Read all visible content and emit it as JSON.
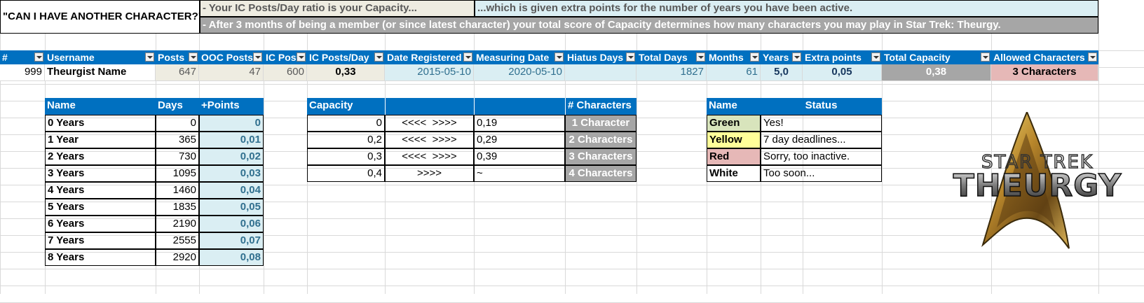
{
  "banner": {
    "question": "\"CAN I HAVE ANOTHER CHARACTER?\"",
    "line1a": "- Your IC Posts/Day ratio is your Capacity...",
    "line1b": "...which is given extra points for the number of years you have been active.",
    "line2": "- After 3 months of being a member (or since latest character) your total score of Capacity determines how many characters you may play in Star Trek: Theurgy."
  },
  "main_table": {
    "headers": [
      "#",
      "Username",
      "Posts",
      "OOC Posts",
      "IC Post",
      "IC Posts/Day",
      "Date Registered",
      "Measuring Date",
      "Hiatus Days",
      "Total Days",
      "Months",
      "Years",
      "Extra points",
      "Total Capacity",
      "Allowed Characters"
    ],
    "row": [
      "999",
      "Theurgist Name",
      "647",
      "47",
      "600",
      "0,33",
      "2015-05-10",
      "2020-05-10",
      "",
      "1827",
      "61",
      "5,0",
      "0,05",
      "0,38",
      "3 Characters"
    ]
  },
  "years_table": {
    "headers": [
      "Name",
      "Days",
      "+Points"
    ],
    "rows": [
      [
        "0 Years",
        "0",
        "0"
      ],
      [
        "1 Year",
        "365",
        "0,01"
      ],
      [
        "2 Years",
        "730",
        "0,02"
      ],
      [
        "3 Years",
        "1095",
        "0,03"
      ],
      [
        "4 Years",
        "1460",
        "0,04"
      ],
      [
        "5 Years",
        "1835",
        "0,05"
      ],
      [
        "6 Years",
        "2190",
        "0,06"
      ],
      [
        "7 Years",
        "2555",
        "0,07"
      ],
      [
        "8 Years",
        "2920",
        "0,08"
      ]
    ]
  },
  "capacity_table": {
    "headers": [
      "Capacity",
      "",
      "",
      "# Characters"
    ],
    "rows": [
      [
        "0",
        "<<<<  >>>>",
        "0,19",
        "1 Character"
      ],
      [
        "0,2",
        "<<<<  >>>>",
        "0,29",
        "2 Characters"
      ],
      [
        "0,3",
        "<<<<  >>>>",
        "0,39",
        "3 Characters"
      ],
      [
        "0,4",
        ">>>>",
        "~",
        "4 Characters"
      ]
    ]
  },
  "status_table": {
    "headers": [
      "Name",
      "Status"
    ],
    "rows": [
      [
        "Green",
        "Yes!",
        "#d8e4bc"
      ],
      [
        "Yellow",
        "7 day deadlines...",
        "#ffff99"
      ],
      [
        "Red",
        "Sorry, too inactive.",
        "#e6b8b7"
      ],
      [
        "White",
        "Too soon...",
        "#ffffff"
      ]
    ]
  },
  "logo": {
    "line1": "STAR TREK",
    "line2": "THEURGY"
  },
  "colors": {
    "header_blue": "#0070c0",
    "beige": "#eeece1",
    "lightblue": "#daeef3",
    "gray": "#a6a6a6",
    "pink": "#e6b8b7"
  }
}
